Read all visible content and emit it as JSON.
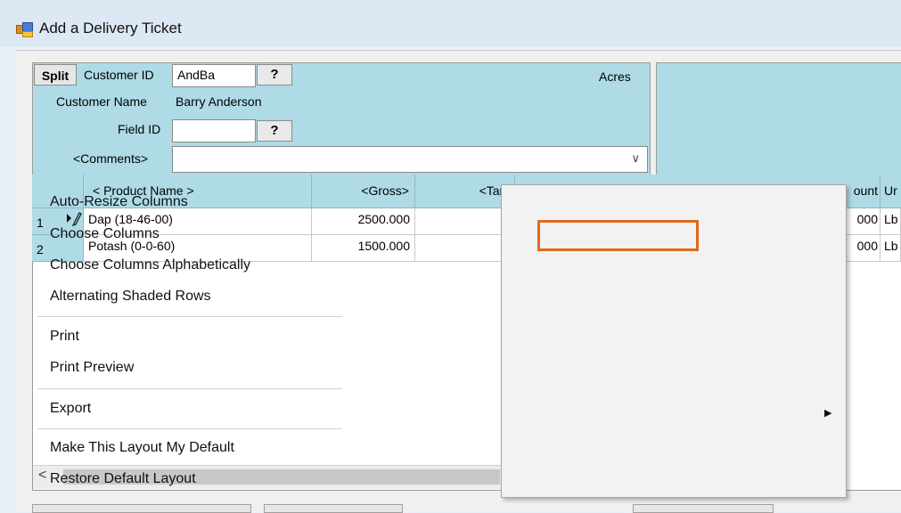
{
  "window": {
    "title": "Add a Delivery Ticket",
    "icon": "app-window-icon"
  },
  "header": {
    "split_label": "Split",
    "customer_id_label": "Customer ID",
    "customer_id_value": "AndBa",
    "lookup_symbol": "?",
    "acres_label": "Acres",
    "customer_name_label": "Customer Name",
    "customer_name_value": "Barry Anderson",
    "field_id_label": "Field ID",
    "field_id_value": "",
    "comments_label": "<Comments>",
    "comments_value": "",
    "dropdown_symbol": "∨"
  },
  "grid": {
    "columns": [
      "< Product Name >",
      "<Gross>",
      "<Tare",
      "ount",
      "Ur"
    ],
    "rows": [
      {
        "num": "1",
        "product": "Dap (18-46-00)",
        "gross": "2500.000",
        "amount_tail": "000",
        "unit_tail": "Lb"
      },
      {
        "num": "2",
        "product": "Potash (0-0-60)",
        "gross": "1500.000",
        "amount_tail": "000",
        "unit_tail": "Lb"
      }
    ],
    "scroll_left_symbol": "<"
  },
  "context_menu": {
    "items": [
      "Auto-Resize Columns",
      "Choose Columns",
      "Choose Columns Alphabetically",
      "Alternating Shaded Rows",
      "Print",
      "Print Preview",
      "Export",
      "Make This Layout My Default",
      "Restore Default Layout"
    ],
    "highlight_item": "Choose Columns",
    "highlight_color": "#e06a1b",
    "submenu_arrow": "▶"
  },
  "colors": {
    "header_bg": "#aedbe6",
    "title_bg": "#dde8f5"
  }
}
